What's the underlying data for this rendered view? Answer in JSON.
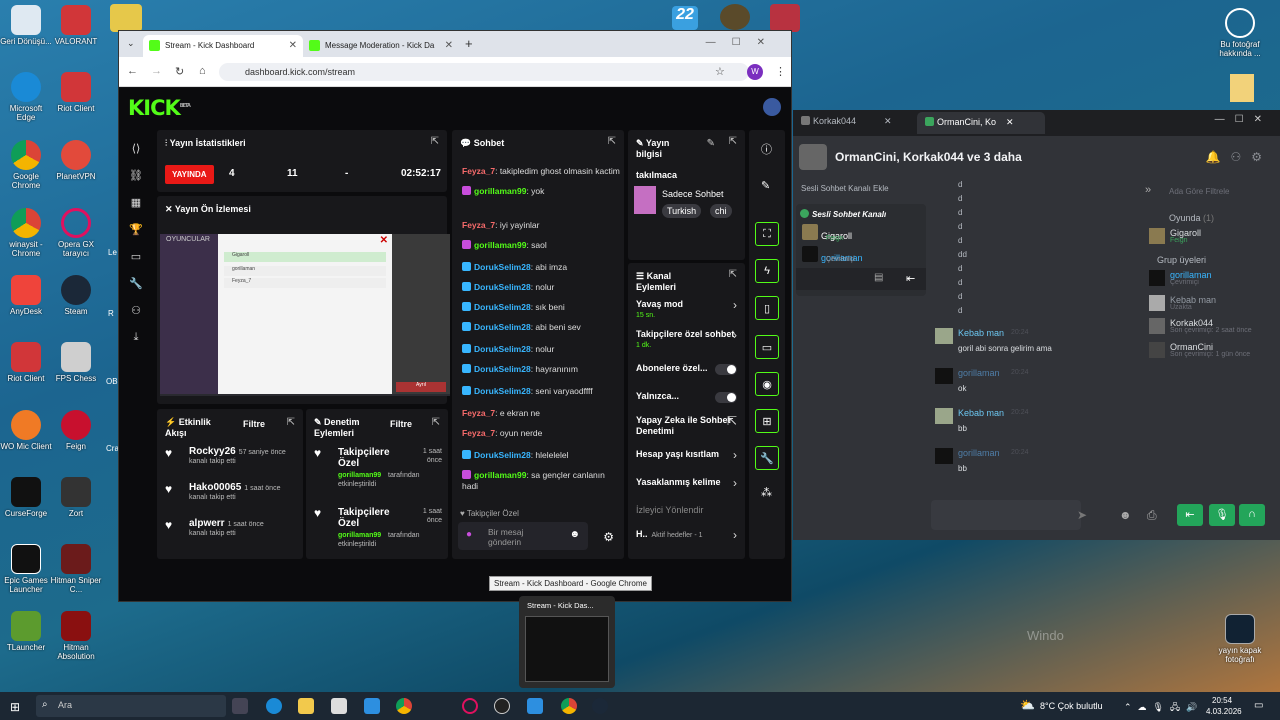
{
  "desktop": {
    "icons": [
      {
        "label": "Geri Dönüşü...",
        "x": 0
      },
      {
        "label": "VALORANT"
      },
      {
        "label": "Microsoft Edge"
      },
      {
        "label": "Riot Client"
      },
      {
        "label": "Google Chrome"
      },
      {
        "label": "PlanetVPN"
      },
      {
        "label": "winaysit - Chrome"
      },
      {
        "label": "Opera GX tarayıcı"
      },
      {
        "label": "AnyDesk"
      },
      {
        "label": "Steam"
      },
      {
        "label": "Riot Client"
      },
      {
        "label": "FPS Chess"
      },
      {
        "label": "WO Mic Client"
      },
      {
        "label": "Feign"
      },
      {
        "label": "CurseForge"
      },
      {
        "label": "Zort"
      },
      {
        "label": "Epic Games Launcher"
      },
      {
        "label": "Hitman Sniper C..."
      },
      {
        "label": "TLauncher"
      },
      {
        "label": "Hitman Absolution"
      }
    ],
    "right_icons": [
      {
        "label": "Bu fotoğraf hakkında ..."
      },
      {
        "label": "yayın kapak fotoğrafı"
      }
    ],
    "partial_labels": [
      "Le",
      "Ch",
      "R",
      "OB",
      "Cra",
      "Ch"
    ]
  },
  "browser": {
    "tabs": [
      {
        "label": "Stream - Kick Dashboard"
      },
      {
        "label": "Message Moderation - Kick Da"
      }
    ],
    "url": "dashboard.kick.com/stream",
    "profile_initial": "W"
  },
  "kick": {
    "logo": "KICK",
    "beta": "BETA",
    "stats": {
      "title": "Yayın İstatistikleri",
      "live": "YAYINDA",
      "viewers": "4",
      "followers": "11",
      "subs": "-",
      "duration": "02:52:17"
    },
    "preview": {
      "title": "Yayın Ön İzlemesi",
      "overlay": "OYUNCULAR",
      "rows": [
        "Gigaroll",
        "gorillaman",
        "Feyza_7"
      ],
      "button": "Ayrıl"
    },
    "activity": {
      "title": "Etkinlik Akışı",
      "filter": "Filtre",
      "items": [
        {
          "name": "Rockyy26",
          "time": "57 saniye önce",
          "desc": "kanalı takip etti"
        },
        {
          "name": "Hako00065",
          "time": "1 saat önce",
          "desc": "kanalı takip etti"
        },
        {
          "name": "alpwerr",
          "time": "1 saat önce",
          "desc": "kanalı takip etti"
        }
      ]
    },
    "moderation": {
      "title": "Denetim Eylemleri",
      "filter": "Filtre",
      "items": [
        {
          "name": "Takipçilere Özel",
          "time": "1 saat önce",
          "by": "gorillaman99",
          "desc": "tarafından etkinleştirildi"
        },
        {
          "name": "Takipçilere Özel",
          "time": "1 saat önce",
          "by": "gorillaman99",
          "desc": "tarafından etkinleştirildi"
        }
      ]
    },
    "chat": {
      "title": "Sohbet",
      "messages": [
        {
          "user": "Feyza_7",
          "text": ": takipledim ghost olmasin kactim",
          "cls": "u-f"
        },
        {
          "user": "gorillaman99",
          "text": ": yok",
          "cls": "u-g"
        },
        {
          "user": "Feyza_7",
          "text": ": iyi yayinlar",
          "cls": "u-f"
        },
        {
          "user": "gorillaman99",
          "text": ": saol",
          "cls": "u-g"
        },
        {
          "user": "DorukSelim28",
          "text": ": abi imza",
          "cls": "u-d"
        },
        {
          "user": "DorukSelim28",
          "text": ": nolur",
          "cls": "u-d"
        },
        {
          "user": "DorukSelim28",
          "text": ": sık beni",
          "cls": "u-d"
        },
        {
          "user": "DorukSelim28",
          "text": ": abi beni sev",
          "cls": "u-d"
        },
        {
          "user": "DorukSelim28",
          "text": ": nolur",
          "cls": "u-d"
        },
        {
          "user": "DorukSelim28",
          "text": ": hayranınım",
          "cls": "u-d"
        },
        {
          "user": "DorukSelim28",
          "text": ": seni varyaodffff",
          "cls": "u-d"
        },
        {
          "user": "Feyza_7",
          "text": ": e ekran ne",
          "cls": "u-f"
        },
        {
          "user": "Feyza_7",
          "text": ": oyun nerde",
          "cls": "u-f"
        },
        {
          "user": "DorukSelim28",
          "text": ": hlelelelel",
          "cls": "u-d"
        },
        {
          "user": "gorillaman99",
          "text": ": sa gençler canlanın hadi",
          "cls": "u-g"
        }
      ],
      "mode": "Takipçiler Özel",
      "placeholder": "Bir mesaj gönderin"
    },
    "info": {
      "title": "Yayın bilgisi",
      "stream_title": "takılmaca",
      "category": "Sadece Sohbet",
      "tags": [
        "Turkish",
        "chi"
      ]
    },
    "actions": {
      "title": "Kanal Eylemleri",
      "items": [
        {
          "label": "Yavaş mod",
          "sub": "15 sn."
        },
        {
          "label": "Takipçilere özel sohbet",
          "sub": "1 dk."
        },
        {
          "label": "Abonelere özel...",
          "sub": ""
        },
        {
          "label": "Yalnızca...",
          "sub": ""
        },
        {
          "label": "Yapay Zeka ile Sohbet Denetimi",
          "sub": ""
        },
        {
          "label": "Hesap yaşı kısıtlam",
          "sub": ""
        },
        {
          "label": "Yasaklanmış kelime",
          "sub": ""
        },
        {
          "label": "İzleyici Yönlendir",
          "sub": ""
        },
        {
          "label": "H..",
          "sub": "Aktif hedefler - 1"
        }
      ]
    }
  },
  "tooltip": "Stream - Kick Dashboard - Google Chrome",
  "thumb_title": "Stream - Kick Das...",
  "discord": {
    "tabs": [
      "Korkak044",
      "OrmanCini, Ko"
    ],
    "header": "OrmanCini, Korkak044 ve 3 daha",
    "voice_add": "Sesli Sohbet Kanalı Ekle",
    "voice_channel": "Sesli Sohbet Kanalı",
    "voice_users": [
      {
        "name": "Gigaroll",
        "sub": "Feign"
      },
      {
        "name": "gorillaman",
        "sub": "Çevrimiçi"
      }
    ],
    "d_lines": [
      "d",
      "d",
      "d",
      "d",
      "d",
      "dd",
      "d",
      "d",
      "d",
      "d"
    ],
    "messages": [
      {
        "user": "Kebab man",
        "time": "20:24",
        "text": "goril abi sonra gelirim ama"
      },
      {
        "user": "gorillaman",
        "time": "20:24",
        "text": "ok"
      },
      {
        "user": "Kebab man",
        "time": "20:24",
        "text": "bb"
      },
      {
        "user": "gorillaman",
        "time": "20:24",
        "text": "bb"
      }
    ],
    "search_placeholder": "Ada Göre Filtrele",
    "playing": "Oyunda",
    "playing_count": "(1)",
    "group_members": "Grup üyeleri",
    "members": [
      {
        "name": "Gigaroll",
        "sub": "Feign"
      },
      {
        "name": "gorillaman",
        "sub": "Çevrimiçi"
      },
      {
        "name": "Kebab man",
        "sub": "Uzakta"
      },
      {
        "name": "Korkak044",
        "sub": "Son çevrimiçi: 2 saat önce"
      },
      {
        "name": "OrmanCini",
        "sub": "Son çevrimiçi: 1 gün önce"
      }
    ]
  },
  "watermark": "Windo",
  "taskbar": {
    "search": "Ara",
    "weather": "8°C  Çok bulutlu",
    "time": "20:54",
    "date": "4.03.2026"
  }
}
